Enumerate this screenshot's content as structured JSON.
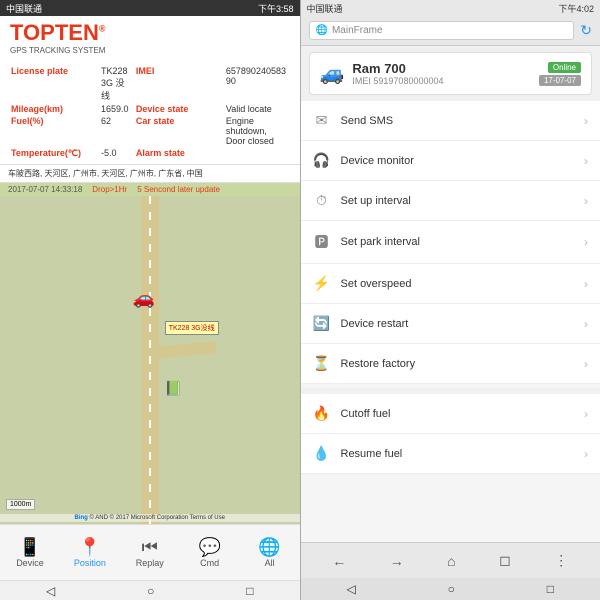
{
  "left": {
    "statusBar": {
      "carrier": "中国联通",
      "icons": "🔔📶",
      "time": "下午3:58"
    },
    "logo": {
      "text": "TOPTEN",
      "reg": "®",
      "subtitle": "GPS TRACKING SYSTEM"
    },
    "vehicleInfo": {
      "licensePlateLabel": "License plate",
      "licensePlate": "TK228 3G 没线",
      "imeiLabel": "IMEI",
      "imei": "657890240583 90",
      "mileageLabel": "Mileage(km)",
      "mileage": "1659.0",
      "deviceStateLabel": "Device state",
      "deviceState": "Valid locate",
      "fuelLabel": "Fuel(%)",
      "fuel": "62",
      "carStateLabel": "Car state",
      "carState": "Engine shutdown, Door closed",
      "tempLabel": "Temperature(℃)",
      "temp": "-5.0",
      "alarmStateLabel": "Alarm state",
      "alarmState": ""
    },
    "address": "车陂西路, 天河区, 广州市, 天河区, 广州市, 广东省, 中国",
    "mapHeader": {
      "datetime": "2017-07-07 14:33:18",
      "drop": "Drop>1Hr",
      "update": "5 Sencond later update"
    },
    "carLabel": "TK228 3G没线",
    "copyright": "© AND © 2017 Microsoft Corporation Terms of Use",
    "zoom": "1000m",
    "nav": {
      "items": [
        {
          "label": "Device",
          "icon": "📱",
          "active": false
        },
        {
          "label": "Position",
          "icon": "📍",
          "active": true
        },
        {
          "label": "Replay",
          "icon": "⏮",
          "active": false
        },
        {
          "label": "Cmd",
          "icon": "💬",
          "active": false
        },
        {
          "label": "All",
          "icon": "🌐",
          "active": false
        }
      ]
    }
  },
  "right": {
    "statusBar": {
      "carrier": "中国联通",
      "icons": "🔔📶",
      "time": "下午4:02"
    },
    "searchPlaceholder": "MainFrame",
    "vehicle": {
      "name": "Ram 700",
      "imei": "IMEI 59197080000004",
      "badgeOnline": "Online",
      "badgeDate": "17-07-07"
    },
    "menuItems": [
      {
        "icon": "✉",
        "label": "Send SMS"
      },
      {
        "icon": "🎧",
        "label": "Device monitor"
      },
      {
        "icon": "⏱",
        "label": "Set up interval"
      },
      {
        "icon": "🅿",
        "label": "Set park interval"
      },
      {
        "icon": "⚡",
        "label": "Set overspeed"
      },
      {
        "icon": "🔄",
        "label": "Device restart"
      },
      {
        "icon": "⏳",
        "label": "Restore factory"
      },
      {
        "icon": "🔥",
        "label": "Cutoff fuel"
      },
      {
        "icon": "💧",
        "label": "Resume fuel"
      }
    ],
    "bottomNav": {
      "back": "←",
      "forward": "→",
      "home": "⌂",
      "tab": "◻",
      "more": "⋮"
    }
  }
}
